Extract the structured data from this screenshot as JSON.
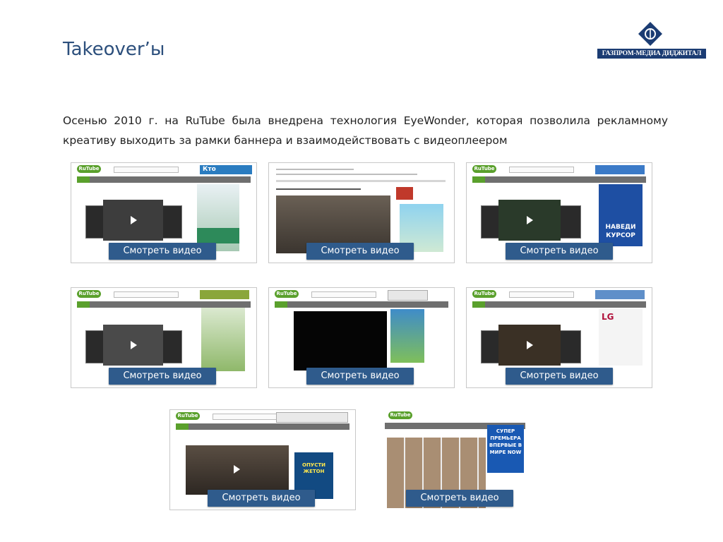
{
  "header": {
    "title": "Takeover’ы",
    "brand": "ГАЗПРОМ-МЕДИА ДИДЖИТАЛ"
  },
  "description": "Осенью 2010 г. на RuTube была внедрена технология EyeWonder, которая позволила рекламному креативу выходить за рамки баннера и взаимодействовать с видеоплеером",
  "common": {
    "site_logo": "RuTube"
  },
  "screens": [
    {
      "button_label": "Смотреть видео",
      "ad_text": "Кто"
    },
    {
      "button_label": "Смотреть видео",
      "ad_text": ""
    },
    {
      "button_label": "Смотреть видео",
      "ad_text": "наведи курсор"
    },
    {
      "button_label": "Смотреть видео",
      "ad_text": ""
    },
    {
      "button_label": "Смотреть видео",
      "ad_text": ""
    },
    {
      "button_label": "Смотреть видео",
      "ad_text": "LG"
    },
    {
      "button_label": "Смотреть видео",
      "ad_text": "ОПУСТИ ЖЕТОН"
    },
    {
      "button_label": "Смотреть видео",
      "ad_text": "СУПЕР ПРЕМЬЕРА ВПЕРВЫЕ В МИРЕ NOW"
    }
  ],
  "colors": {
    "title": "#2c4f7c",
    "button": "#2f5b8c",
    "brand": "#1b3c73",
    "rutube_green": "#5aa02c"
  }
}
